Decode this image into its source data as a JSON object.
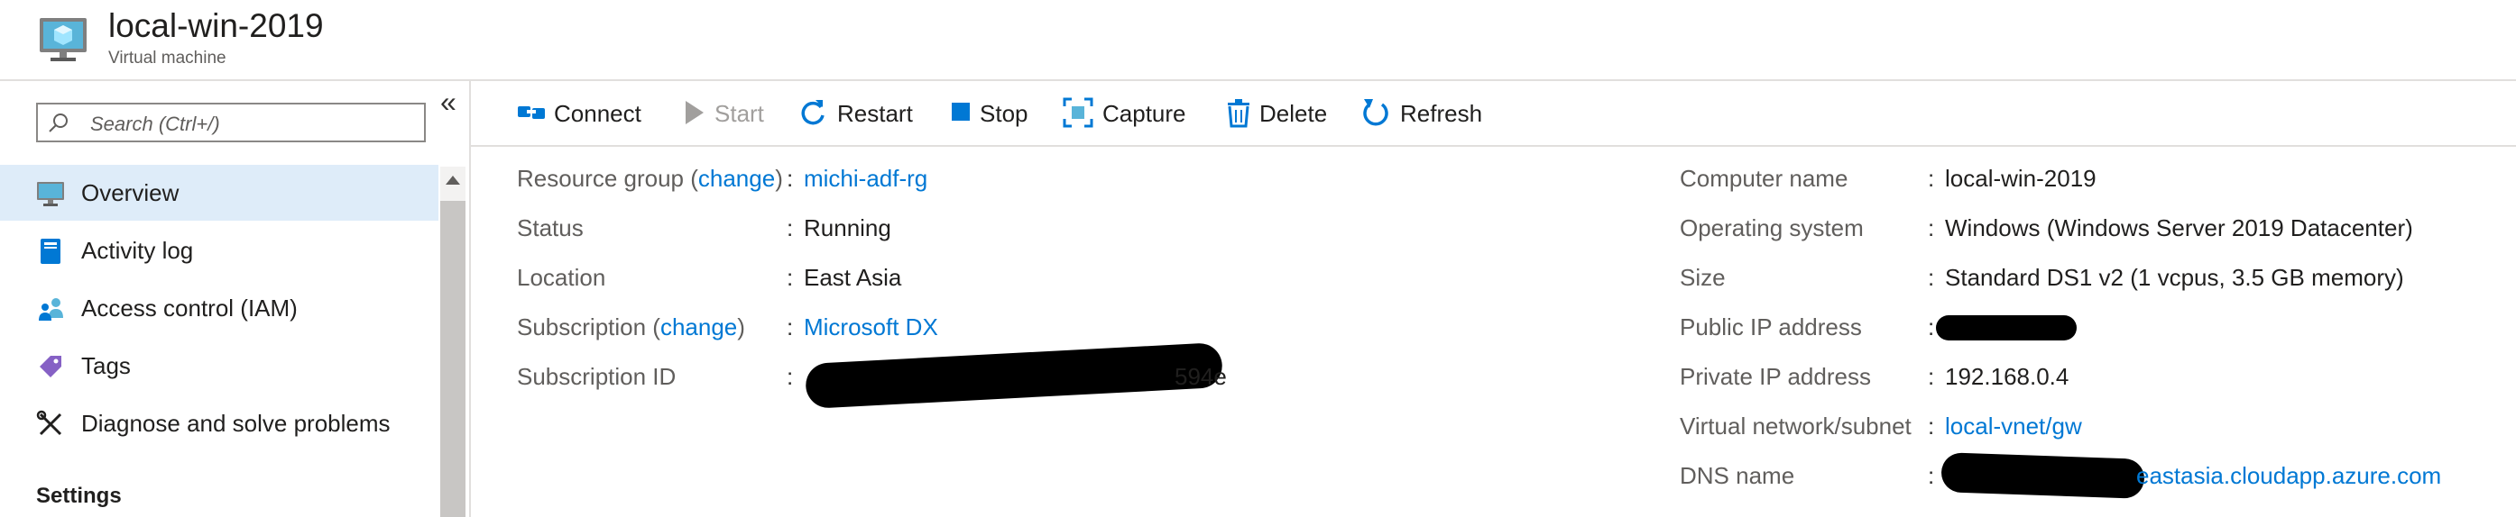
{
  "header": {
    "title": "local-win-2019",
    "subtitle": "Virtual machine"
  },
  "sidebar": {
    "search_placeholder": "Search (Ctrl+/)",
    "collapse_label": "«",
    "items": [
      {
        "label": "Overview",
        "icon": "monitor-icon",
        "active": true
      },
      {
        "label": "Activity log",
        "icon": "book-icon"
      },
      {
        "label": "Access control (IAM)",
        "icon": "people-icon"
      },
      {
        "label": "Tags",
        "icon": "tag-icon"
      },
      {
        "label": "Diagnose and solve problems",
        "icon": "wrench-icon"
      }
    ],
    "section_settings": "Settings"
  },
  "toolbar": {
    "connect": "Connect",
    "start": "Start",
    "restart": "Restart",
    "stop": "Stop",
    "capture": "Capture",
    "delete": "Delete",
    "refresh": "Refresh"
  },
  "essentials": {
    "left": {
      "resource_group_label": "Resource group",
      "resource_group_change": "change",
      "resource_group_value": "michi-adf-rg",
      "status_label": "Status",
      "status_value": "Running",
      "location_label": "Location",
      "location_value": "East Asia",
      "subscription_label": "Subscription",
      "subscription_change": "change",
      "subscription_value": "Microsoft DX",
      "subscription_id_label": "Subscription ID",
      "subscription_id_visible_end": "594e"
    },
    "right": {
      "computer_name_label": "Computer name",
      "computer_name_value": "local-win-2019",
      "os_label": "Operating system",
      "os_value": "Windows (Windows Server 2019 Datacenter)",
      "size_label": "Size",
      "size_value": "Standard DS1 v2 (1 vcpus, 3.5 GB memory)",
      "public_ip_label": "Public IP address",
      "private_ip_label": "Private IP address",
      "private_ip_value": "192.168.0.4",
      "vnet_label": "Virtual network/subnet",
      "vnet_value": "local-vnet/gw",
      "dns_label": "DNS name",
      "dns_visible_end": "eastasia.cloudapp.azure.com"
    },
    "colon": ":"
  },
  "colors": {
    "accent": "#0078d4",
    "active_bg": "#deecf9",
    "border": "#e1dfdd"
  }
}
